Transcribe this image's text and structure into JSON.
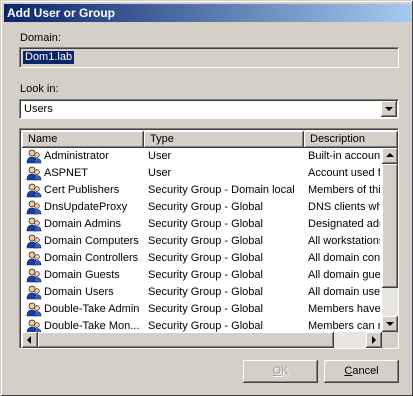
{
  "window": {
    "title": "Add User or Group"
  },
  "domain": {
    "label": "Domain:",
    "value": "Dom1.lab"
  },
  "look_in": {
    "label": "Look in:",
    "value": "Users"
  },
  "list": {
    "columns": [
      "Name",
      "Type",
      "Description"
    ],
    "rows": [
      {
        "name": "Administrator",
        "type": "User",
        "description": "Built-in account"
      },
      {
        "name": "ASPNET",
        "type": "User",
        "description": "Account used fo"
      },
      {
        "name": "Cert Publishers",
        "type": "Security Group - Domain local",
        "description": "Members of this"
      },
      {
        "name": "DnsUpdateProxy",
        "type": "Security Group - Global",
        "description": "DNS clients whi"
      },
      {
        "name": "Domain Admins",
        "type": "Security Group - Global",
        "description": "Designated adm"
      },
      {
        "name": "Domain Computers",
        "type": "Security Group - Global",
        "description": "All workstations"
      },
      {
        "name": "Domain Controllers",
        "type": "Security Group - Global",
        "description": "All domain contr"
      },
      {
        "name": "Domain Guests",
        "type": "Security Group - Global",
        "description": "All domain gues"
      },
      {
        "name": "Domain Users",
        "type": "Security Group - Global",
        "description": "All domain users"
      },
      {
        "name": "Double-Take Admin",
        "type": "Security Group - Global",
        "description": "Members have f"
      },
      {
        "name": "Double-Take Mon...",
        "type": "Security Group - Global",
        "description": "Members can m"
      }
    ]
  },
  "buttons": {
    "ok": "OK",
    "cancel": "Cancel"
  }
}
